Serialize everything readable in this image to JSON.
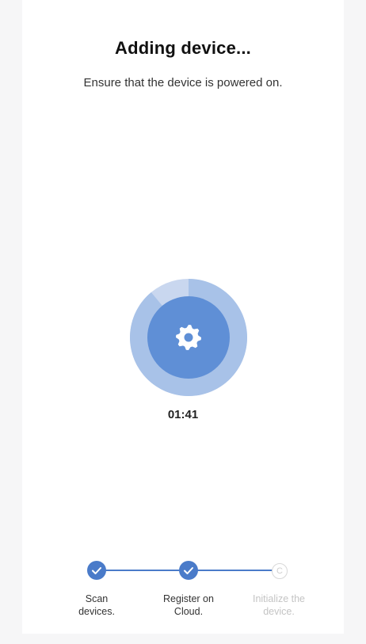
{
  "header": {
    "title": "Adding device...",
    "subtitle": "Ensure that the device is powered on."
  },
  "progress": {
    "timer": "01:41",
    "fraction_elapsed": 0.89,
    "center_icon": "gear-icon",
    "colors": {
      "outer_track": "#c9d7ef",
      "outer_fill": "#a8c2e8",
      "inner": "#5f8fd6",
      "icon": "#ffffff"
    }
  },
  "steps": [
    {
      "label_line1": "Scan",
      "label_line2": "devices.",
      "status": "done",
      "icon": "check-icon"
    },
    {
      "label_line1": "Register on",
      "label_line2": "Cloud.",
      "status": "done",
      "icon": "check-icon"
    },
    {
      "label_line1": "Initialize the",
      "label_line2": "device.",
      "status": "pending",
      "icon": "pending-c-icon",
      "glyph": "C"
    }
  ],
  "colors": {
    "accent": "#4a7bc9",
    "pending": "#c4c4c4"
  }
}
